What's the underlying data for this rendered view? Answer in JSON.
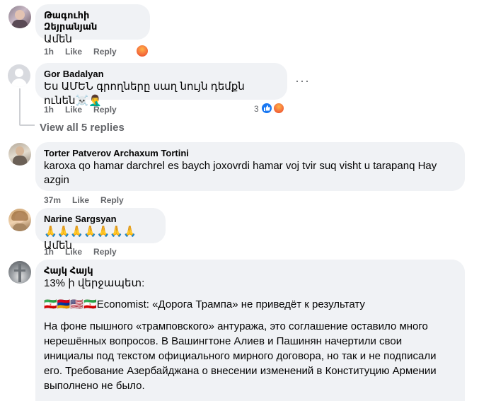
{
  "comments": [
    {
      "author": "Թագուհի Զեյրանյան",
      "text": "Ամեն",
      "time": "1h",
      "like_label": "Like",
      "reply_label": "Reply"
    },
    {
      "author": "Gor Badalyan",
      "text": "Ես ԱՄԵՆ գրողները սաղ նույն դեմքն ունեն☠️🤦‍♂️",
      "time": "1h",
      "like_label": "Like",
      "reply_label": "Reply",
      "reaction_count": "3",
      "more_label": "···"
    },
    {
      "author": "Torter Patverov Archaxum Tortini",
      "text": "karoxa qo hamar darchrel es baych joxovrdi hamar voj tvir suq visht u tarapanq Hay azgin",
      "time": "37m",
      "like_label": "Like",
      "reply_label": "Reply"
    },
    {
      "author": "Narine Sargsyan",
      "text": "🙏🙏🙏🙏🙏🙏🙏Ամեն",
      "time": "1h",
      "like_label": "Like",
      "reply_label": "Reply"
    },
    {
      "author": "Հայկ Հայկ",
      "line1": "13% ի վերջապետ:",
      "line2_flags": "🇮🇷🇦🇲🇺🇸🇮🇷",
      "line2_text": "Economist: «Дорога Трампа» не приведёт к результату",
      "paragraph": "На фоне пышного «трамповского» антуража, это соглашение оставило много нерешённых вопросов. В Вашингтоне Алиев и Пашинян начертили свои инициалы под текстом официального мирного договора, но так и не подписали его. Требование Азербайджана о внесении изменений в Конституцию Армении выполнено не было."
    }
  ],
  "view_replies_label": "View all 5 replies",
  "colors": {
    "bubble": "#f0f2f5",
    "meta": "#65676b",
    "like_blue": "#1877f2",
    "angry_orange": "#f5733d"
  }
}
